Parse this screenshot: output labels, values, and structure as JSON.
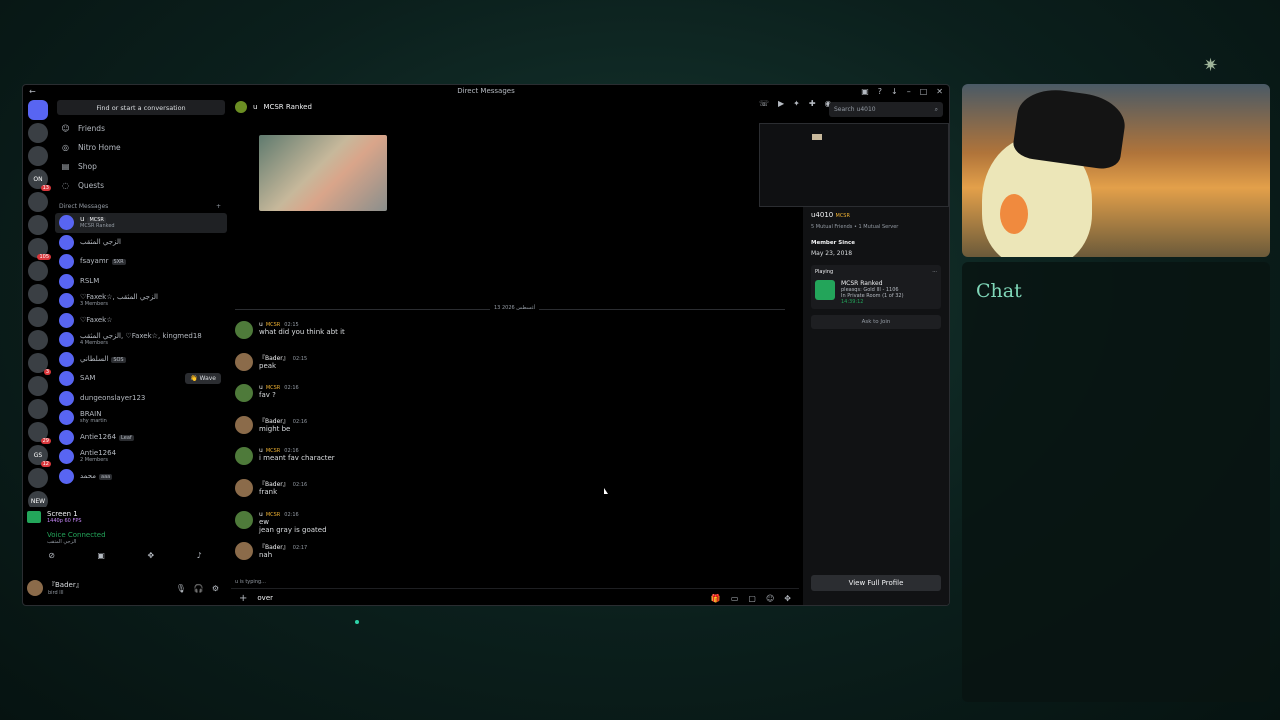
{
  "window": {
    "title": "Direct Messages"
  },
  "servers": [
    {
      "label": "",
      "badge": ""
    },
    {
      "label": "",
      "badge": ""
    },
    {
      "label": "",
      "badge": ""
    },
    {
      "label": "ON",
      "badge": "13"
    },
    {
      "label": "",
      "badge": ""
    },
    {
      "label": "",
      "badge": ""
    },
    {
      "label": "",
      "badge": "105"
    },
    {
      "label": "",
      "badge": ""
    },
    {
      "label": "",
      "badge": ""
    },
    {
      "label": "",
      "badge": ""
    },
    {
      "label": "",
      "badge": ""
    },
    {
      "label": "",
      "badge": "3"
    },
    {
      "label": "",
      "badge": ""
    },
    {
      "label": "",
      "badge": ""
    },
    {
      "label": "",
      "badge": "29"
    },
    {
      "label": "GS",
      "badge": "12"
    },
    {
      "label": "",
      "badge": ""
    },
    {
      "label": "NEW",
      "badge": ""
    }
  ],
  "sidebar": {
    "search_label": "Find or start a conversation",
    "nav": [
      {
        "label": "Friends"
      },
      {
        "label": "Nitro Home"
      },
      {
        "label": "Shop"
      },
      {
        "label": "Quests"
      }
    ],
    "dm_header": "Direct Messages",
    "dm_add": "+",
    "dms": [
      {
        "name": "u",
        "tag": "MCSR",
        "sub": "MCSR Ranked",
        "active": true
      },
      {
        "name": "الزجي المثقب",
        "tag": "",
        "sub": ""
      },
      {
        "name": "fsayamr",
        "tag": "SXR",
        "sub": ""
      },
      {
        "name": "RSLM",
        "tag": "",
        "sub": ""
      },
      {
        "name": "♡Faxek☆, الزجي المثقب",
        "tag": "",
        "sub": "3 Members"
      },
      {
        "name": "♡Faxek☆",
        "tag": "",
        "sub": ""
      },
      {
        "name": "الزجي المثقب, ♡Faxek☆, kingmed18",
        "tag": "",
        "sub": "4 Members"
      },
      {
        "name": "السلطاني",
        "tag": "SOS",
        "sub": ""
      },
      {
        "name": "SAM",
        "tag": "",
        "sub": ""
      },
      {
        "name": "dungeonslayer123",
        "tag": "",
        "sub": ""
      },
      {
        "name": "BRAIN",
        "tag": "",
        "sub": "shy martin"
      },
      {
        "name": "Antie1264",
        "tag": "Leaf",
        "sub": ""
      },
      {
        "name": "Antie1264",
        "tag": "",
        "sub": "2 Members"
      },
      {
        "name": "محمد",
        "tag": "aaa",
        "sub": ""
      }
    ],
    "wave_label": "👋 Wave",
    "screen": {
      "title": "Screen 1",
      "sub": "1440p 60 FPS"
    },
    "voice": {
      "status": "Voice Connected",
      "channel": "الزجي المثقب"
    },
    "user": {
      "name": "『Bader』",
      "status": "bird lll"
    }
  },
  "chat": {
    "recipient": "u",
    "recipient_tag": "MCSR Ranked",
    "search_placeholder": "Search u4010",
    "date_divider": "13 أغسطس 2026",
    "messages": [
      {
        "author": "u",
        "tag": "MCSR",
        "time": "02:15",
        "text": "what did you think abt it",
        "bader": false
      },
      {
        "author": "『Bader』",
        "tag": "",
        "time": "02:15",
        "text": "peak",
        "bader": true
      },
      {
        "author": "u",
        "tag": "MCSR",
        "time": "02:16",
        "text": "fav ?",
        "bader": false
      },
      {
        "author": "『Bader』",
        "tag": "",
        "time": "02:16",
        "text": "might be",
        "bader": true
      },
      {
        "author": "u",
        "tag": "MCSR",
        "time": "02:16",
        "text": "i meant fav character",
        "bader": false
      },
      {
        "author": "『Bader』",
        "tag": "",
        "time": "02:16",
        "text": "frank",
        "bader": true
      },
      {
        "author": "u",
        "tag": "MCSR",
        "time": "02:16",
        "text": "ew\njean gray is goated",
        "bader": false
      },
      {
        "author": "『Bader』",
        "tag": "",
        "time": "02:17",
        "text": "nah",
        "bader": true
      }
    ],
    "typing": "u is typing...",
    "composer_value": "over"
  },
  "profile": {
    "name": "u4010",
    "tag": "MCSR",
    "mutual": "5 Mutual Friends • 1 Mutual Server",
    "member_since_label": "Member Since",
    "member_since": "May 23, 2018",
    "playing_label": "Playing",
    "game": "MCSR Ranked",
    "game_detail": "pleasqs: Gold III - 1106",
    "game_room": "In Private Room (1 of 32)",
    "game_timer": "14:39:12",
    "ask_join": "Ask to Join",
    "view_full": "View Full Profile"
  },
  "overlay": {
    "chat_title": "Chat"
  },
  "colors": {
    "accent": "#5865f2",
    "online": "#23a55a",
    "chat_title": "#7fd6b8"
  }
}
